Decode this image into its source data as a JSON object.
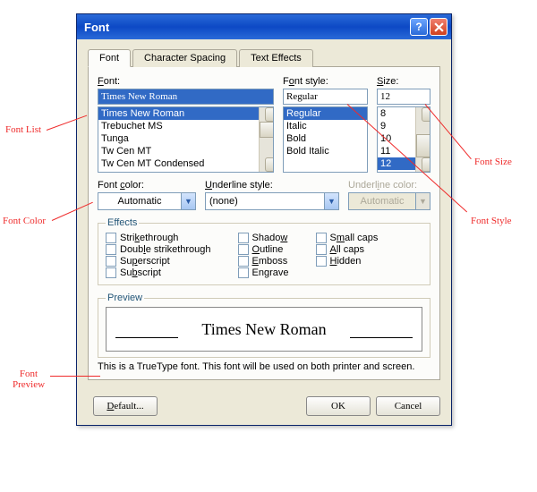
{
  "window": {
    "title": "Font"
  },
  "tabs": [
    "Font",
    "Character Spacing",
    "Text Effects"
  ],
  "font_section": {
    "label": "Font:",
    "value": "Times New Roman",
    "items": [
      "Times New Roman",
      "Trebuchet MS",
      "Tunga",
      "Tw Cen MT",
      "Tw Cen MT Condensed"
    ]
  },
  "style_section": {
    "label": "Font style:",
    "value": "Regular",
    "items": [
      "Regular",
      "Italic",
      "Bold",
      "Bold Italic"
    ]
  },
  "size_section": {
    "label": "Size:",
    "value": "12",
    "items": [
      "8",
      "9",
      "10",
      "11",
      "12"
    ]
  },
  "font_color": {
    "label": "Font color:",
    "value": "Automatic"
  },
  "underline_style": {
    "label": "Underline style:",
    "value": "(none)"
  },
  "underline_color": {
    "label": "Underline color:",
    "value": "Automatic"
  },
  "effects": {
    "legend": "Effects",
    "col1": [
      "Strikethrough",
      "Double strikethrough",
      "Superscript",
      "Subscript"
    ],
    "col2": [
      "Shadow",
      "Outline",
      "Emboss",
      "Engrave"
    ],
    "col3": [
      "Small caps",
      "All caps",
      "Hidden"
    ]
  },
  "preview": {
    "legend": "Preview",
    "text": "Times New Roman"
  },
  "note": "This is a TrueType font. This font will be used on both printer and screen.",
  "buttons": {
    "default": "Default...",
    "ok": "OK",
    "cancel": "Cancel"
  },
  "callouts": {
    "font_list": "Font List",
    "font_color": "Font Color",
    "font_preview": "Font\nPreview",
    "font_size": "Font Size",
    "font_style": "Font Style"
  }
}
